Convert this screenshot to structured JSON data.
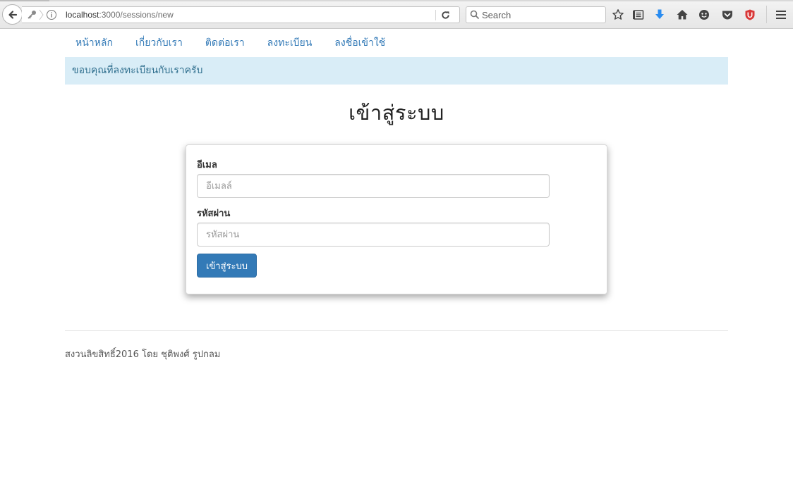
{
  "browser": {
    "url_host": "localhost",
    "url_path": ":3000/sessions/new",
    "search_placeholder": "Search"
  },
  "nav": {
    "items": [
      {
        "label": "หน้าหลัก"
      },
      {
        "label": "เกี่ยวกับเรา"
      },
      {
        "label": "ติดต่อเรา"
      },
      {
        "label": "ลงทะเบียน"
      },
      {
        "label": "ลงชื่อเข้าใช้"
      }
    ]
  },
  "alert": {
    "text": "ขอบคุณที่ลงทะเบียนกับเราครับ"
  },
  "page": {
    "title": "เข้าสู่ระบบ"
  },
  "form": {
    "email_label": "อีเมล",
    "email_placeholder": "อีเมลล์",
    "email_value": "",
    "password_label": "รหัสผ่าน",
    "password_placeholder": "รหัสผ่าน",
    "password_value": "",
    "submit_label": "เข้าสู่ระบบ"
  },
  "footer": {
    "text": "สงวนลิขสิทธิ์2016 โดย ชุติพงศ์ รูปกลม"
  },
  "colors": {
    "link": "#337ab7",
    "alert_bg": "#d9edf7",
    "alert_text": "#31708f",
    "button_bg": "#337ab7",
    "download_arrow": "#2a8cf0",
    "ublock_red": "#d93838"
  },
  "icons": {
    "back": "back-arrow-icon",
    "key": "key-icon",
    "info": "info-icon",
    "reload": "reload-icon",
    "search": "search-icon",
    "bookmark": "star-icon",
    "reading_list": "reading-list-icon",
    "download": "download-icon",
    "home": "home-icon",
    "emoji": "emoji-icon",
    "pocket": "pocket-icon",
    "ublock": "ublock-icon",
    "menu": "hamburger-menu-icon"
  }
}
